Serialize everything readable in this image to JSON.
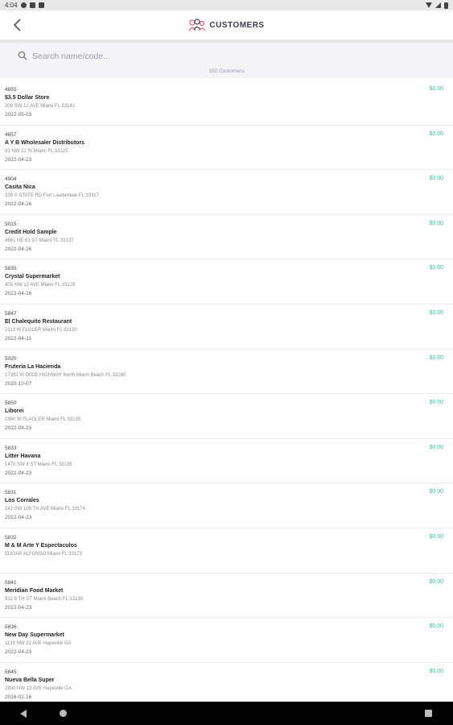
{
  "status_bar": {
    "time": "4:04"
  },
  "header": {
    "title": "CUSTOMERS"
  },
  "search": {
    "placeholder": "Search name/code...",
    "value": ""
  },
  "summary": {
    "count_label": "192 Customers"
  },
  "customers": [
    {
      "code": "4855",
      "name": "$3.5 Dollar Store",
      "address": "309 SW 12 AVE Miami FL 33142",
      "date": "2022-05-03",
      "amount": "$0.00"
    },
    {
      "code": "4857",
      "name": "A Y B Wholesaler Distributors",
      "address": "93 NW 22 St Miami FL 33125",
      "date": "2022-04-23",
      "amount": "$0.00"
    },
    {
      "code": "4904",
      "name": "Casita Nica",
      "address": "339 S STATE RD Fort Lauderdale FL 33317",
      "date": "2022-04-26",
      "amount": "$0.00"
    },
    {
      "code": "5015",
      "name": "Credit Hold Sample",
      "address": "4661 NE 61 ST Miami FL 33137",
      "date": "2022-04-26",
      "amount": "$0.00"
    },
    {
      "code": "5835",
      "name": "Crystal Supermarket",
      "address": "405 NW 12 AVE Miami FL 33128",
      "date": "2022-04-26",
      "amount": "$0.00"
    },
    {
      "code": "5847",
      "name": "El Chalequito Restaurant",
      "address": "2113 W FLGLER Miami FL 33130",
      "date": "2022-04-21",
      "amount": "$0.00"
    },
    {
      "code": "5020",
      "name": "Fruteria La Hacienda",
      "address": "17392 W DIXIE HIGHWAY North Miami Beach FL 33160",
      "date": "2020-10-07",
      "amount": "$0.00"
    },
    {
      "code": "5850",
      "name": "Liborei",
      "address": "1580 W FLAGLER Miami FL 33135",
      "date": "2022-04-23",
      "amount": "$0.00"
    },
    {
      "code": "5833",
      "name": "Litter Havana",
      "address": "1470 SW 8 ST Miami FL 33135",
      "date": "2022-04-23",
      "amount": "$0.00"
    },
    {
      "code": "5831",
      "name": "Los Corrales",
      "address": "242 SW 109 TH AVE Miami FL 33174",
      "date": "2022-04-23",
      "amount": "$0.00"
    },
    {
      "code": "5832",
      "name": "M & M Arte Y Espectaculos",
      "address": "EDGAR ALFONSO Miami FL 33173",
      "date": "",
      "amount": "$0.00"
    },
    {
      "code": "5841",
      "name": "Meridian Food Market",
      "address": "812 6 TH ST Miami Beach FL 33139",
      "date": "2022-04-23",
      "amount": "$0.00"
    },
    {
      "code": "5836",
      "name": "New Day Supermarket",
      "address": "1139 NW 22 AVE Hapeville GA",
      "date": "2022-04-23",
      "amount": "$0.00"
    },
    {
      "code": "5845",
      "name": "Nueva Bella Super",
      "address": "2800 NW 13 AVE Hapeville GA",
      "date": "2016-02-16",
      "amount": "$0.00"
    }
  ],
  "colors": {
    "amount": "#3fbf9c",
    "header_text": "#3d3d52",
    "logo_accent": "#e05a6a"
  },
  "icons": {
    "back": "chevron-left-icon",
    "search": "search-icon",
    "logo": "customers-logo-icon"
  }
}
